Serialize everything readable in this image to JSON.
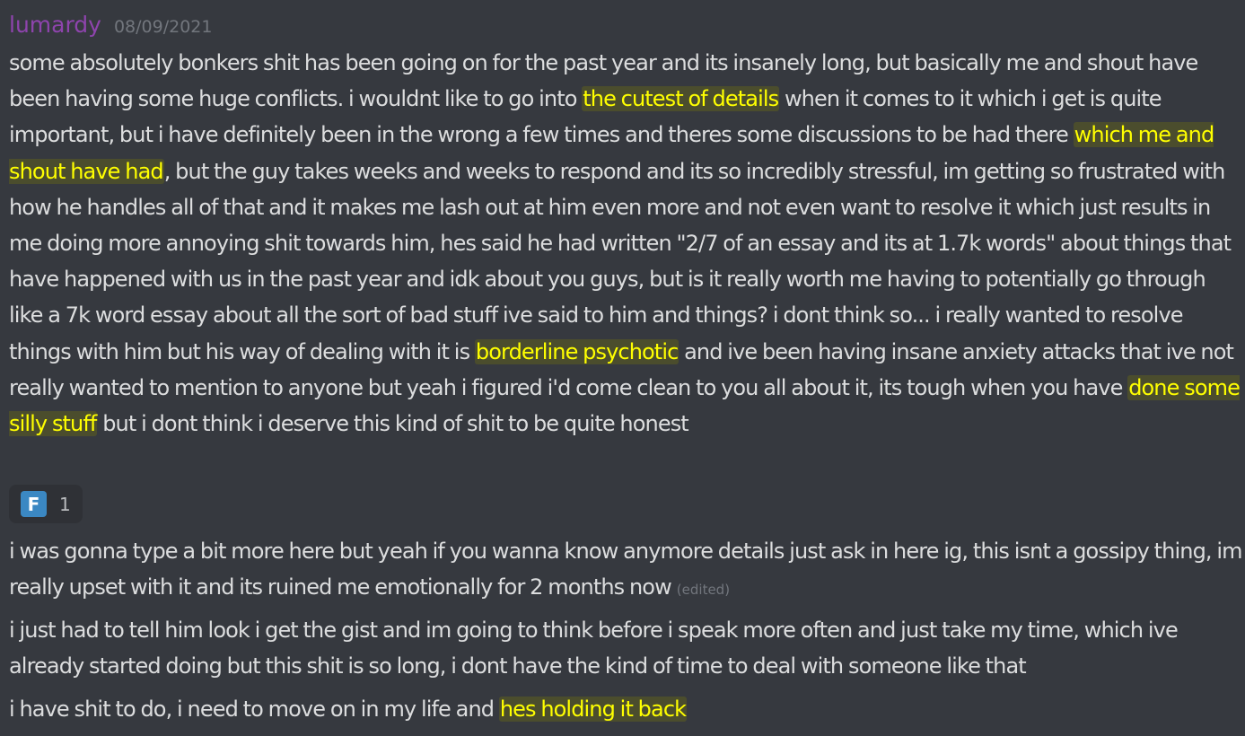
{
  "message": {
    "author": "lumardy",
    "timestamp": "08/09/2021",
    "colors": {
      "background": "#36393f",
      "username": "#8e44ad",
      "text": "#dcddde",
      "highlight_text": "#ffff00",
      "reaction_bg": "#2f3136",
      "reaction_emoji_bg": "#3b88c3"
    },
    "m1": {
      "s1": "some absolutely bonkers shit has been going on for the past year and its insanely long, but basically me and shout have been having some huge conflicts. i wouldnt like to go into ",
      "h1": "the cutest of details",
      "s2": " when it comes to it which i get is quite important, but i have definitely been in the wrong a few times and theres some discussions to be had there ",
      "h2": "which me and shout have had",
      "s3": ", but the guy takes weeks and weeks to respond and its so incredibly stressful, im getting so frustrated with how he handles all of that and it makes me lash out at him even more and not even want to resolve it which just results in me doing more annoying shit towards him, hes said he had written \"2/7 of an essay and its at 1.7k words\" about things that have happened with us in the past year and idk about you guys, but is it really worth me having to potentially go through like a 7k word essay about all the sort of bad stuff ive said to him and things? i dont think so... i really wanted to resolve things with him but his way of dealing with it is ",
      "h3": "borderline psychotic",
      "s4": " and ive been having insane anxiety attacks that ive not really wanted to mention to anyone but yeah i figured i'd come clean to you all about it, its tough when you have ",
      "h4": "done some silly stuff",
      "s5": " but i dont think i deserve this kind of shit to be quite honest"
    },
    "reaction": {
      "emoji_icon": "regional-indicator-f",
      "emoji_letter": "F",
      "count": "1"
    },
    "m2": {
      "text": "i was gonna type a bit more here but yeah if you wanna know anymore details just ask in here ig, this isnt a gossipy thing, im really upset with it and its ruined me emotionally for 2 months now",
      "edited": "(edited)"
    },
    "m3": {
      "text": "i just had to tell him look i get the gist and im going to think before i speak more often and just take my time, which ive already started doing but this shit is so long, i dont have the kind of time to deal with someone like that"
    },
    "m4": {
      "s1": "i have shit to do, i need to move on in my life and ",
      "h1": "hes holding it back"
    }
  }
}
